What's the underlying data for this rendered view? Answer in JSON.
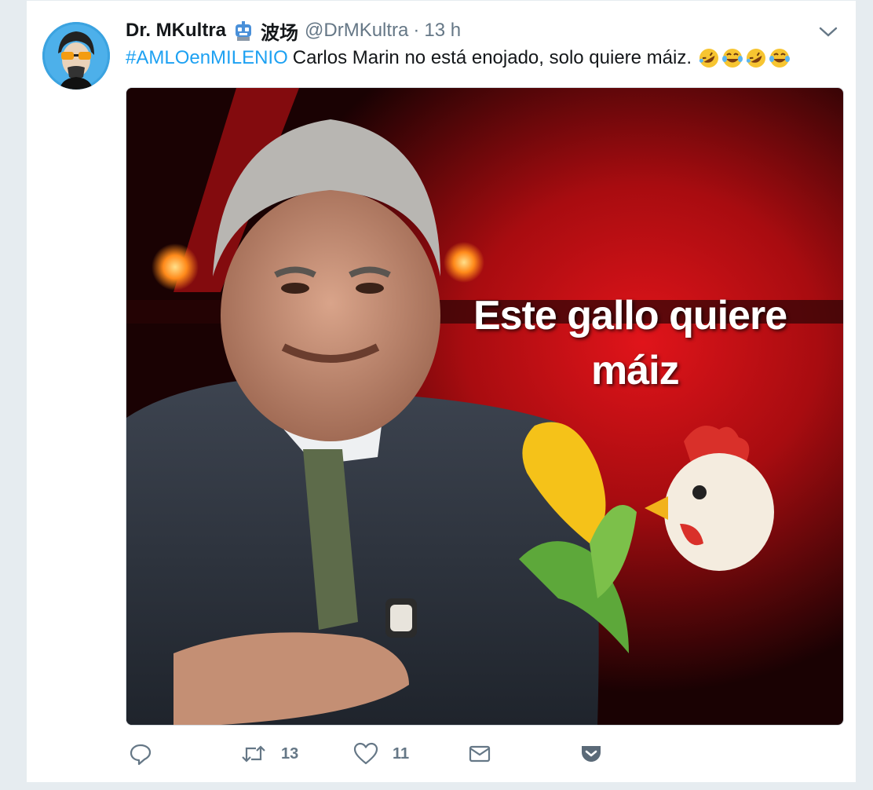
{
  "tweet": {
    "author_name": "Dr. MKultra",
    "author_name_cjk": "波场",
    "handle": "@DrMKultra",
    "separator": "·",
    "time": "13 h",
    "hashtag": "#AMLOenMILENIO",
    "text": "Carlos Marin no está enojado, solo quiere máiz.",
    "trailing_emojis": [
      "rolling-on-floor-laughing",
      "face-with-tears-of-joy",
      "rolling-on-floor-laughing",
      "face-with-tears-of-joy"
    ]
  },
  "media": {
    "caption_line1": "Este gallo quiere",
    "caption_line2": "máiz",
    "emojis": [
      "corn",
      "rooster"
    ]
  },
  "actions": {
    "reply": {
      "icon": "reply-icon",
      "count": ""
    },
    "retweet": {
      "icon": "retweet-icon",
      "count": "13"
    },
    "like": {
      "icon": "heart-icon",
      "count": "11"
    },
    "dm": {
      "icon": "envelope-icon",
      "count": ""
    },
    "pocket": {
      "icon": "pocket-icon",
      "count": ""
    }
  },
  "colors": {
    "link": "#1da1f2",
    "text": "#14171a",
    "muted": "#657786",
    "background": "#e6ecf0"
  }
}
